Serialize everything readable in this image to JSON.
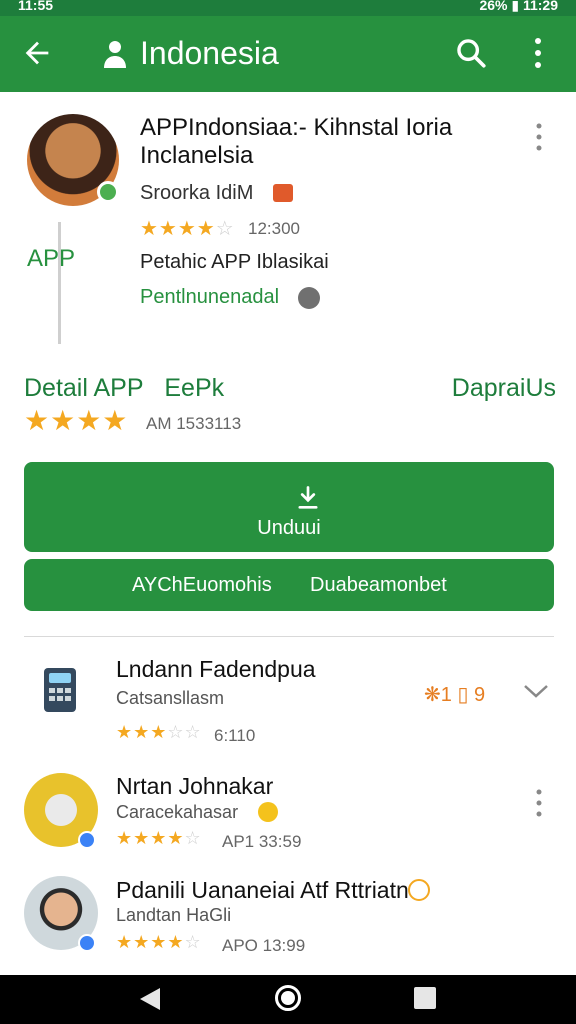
{
  "status_bar": {
    "time": "11:55",
    "right_text": "26% ▮ 11:29"
  },
  "app_bar": {
    "title": "Indonesia"
  },
  "app": {
    "title": "APPIndonsiaa:- Kihnstal Ioria Inclanelsia",
    "developer": "Sroorka IdiM",
    "rating_count": "12:300",
    "side_label": "APP",
    "subtitle": "Petahic APP Iblasikai",
    "link": "Pentlnunenadal"
  },
  "details": {
    "left": "Detail APP",
    "middle": "EePk",
    "right": "DapraiUs",
    "count": "AM 1533113"
  },
  "buttons": {
    "install": "Unduui",
    "left": "AYChEuomohis",
    "right": "Duabeamonbet"
  },
  "list": [
    {
      "title": "Lndann Fadendpua",
      "subtitle": "Catsansllasm",
      "meta": "6:110",
      "badge": "1",
      "badge2": "9"
    },
    {
      "title": "Nrtan Johnakar",
      "subtitle": "Caracekahasar",
      "meta": "AP1 33:59"
    },
    {
      "title": "Pdanili Uananeiai Atf Rttriatn",
      "subtitle": "Landtan HaGli",
      "meta": "APO 13:99"
    }
  ],
  "colors": {
    "primary": "#27913f",
    "star": "#f4a821"
  }
}
